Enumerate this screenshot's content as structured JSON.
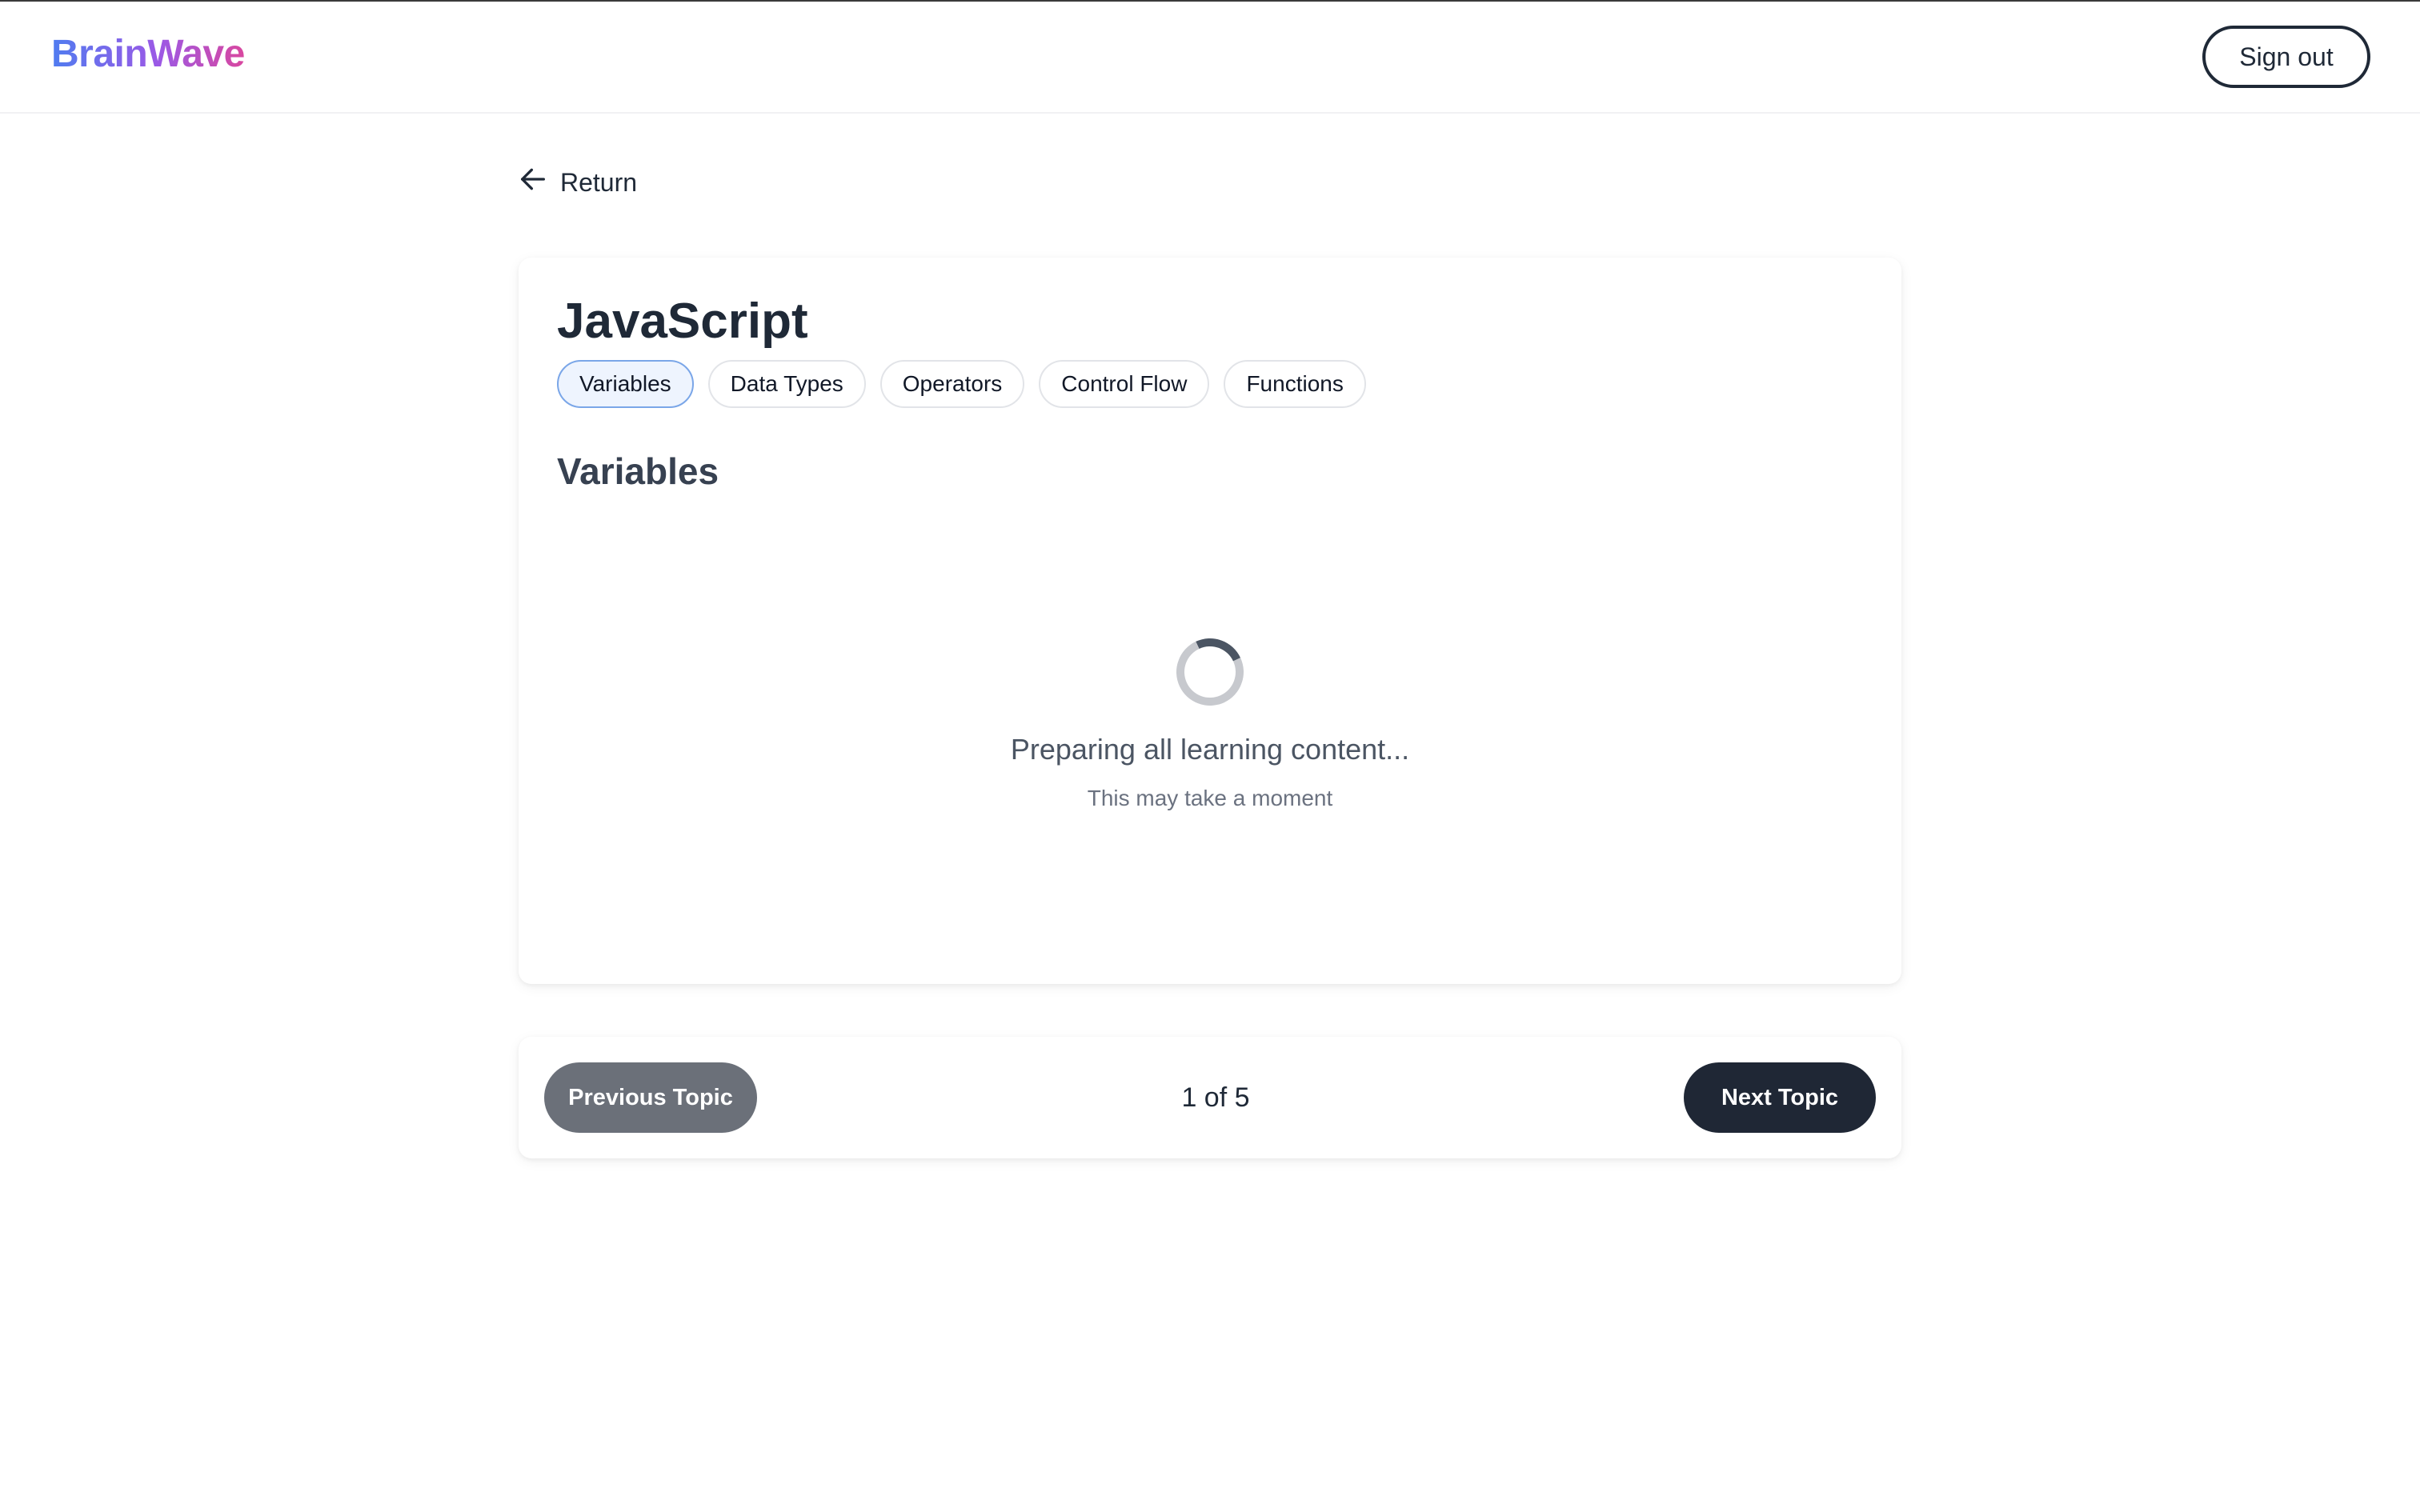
{
  "header": {
    "logo": "BrainWave",
    "signout_label": "Sign out"
  },
  "nav": {
    "return_label": "Return"
  },
  "course": {
    "title": "JavaScript",
    "topics": [
      {
        "label": "Variables",
        "active": true
      },
      {
        "label": "Data Types",
        "active": false
      },
      {
        "label": "Operators",
        "active": false
      },
      {
        "label": "Control Flow",
        "active": false
      },
      {
        "label": "Functions",
        "active": false
      }
    ],
    "current_topic": "Variables"
  },
  "loading": {
    "message": "Preparing all learning content...",
    "submessage": "This may take a moment"
  },
  "pager": {
    "prev_label": "Previous Topic",
    "next_label": "Next Topic",
    "counter": "1 of 5"
  },
  "colors": {
    "logo_gradient_start": "#4f7cf0",
    "logo_gradient_end": "#d9479f",
    "active_chip_bg": "#eef4fe",
    "active_chip_border": "#7aa6e8",
    "prev_button": "#6b7079",
    "next_button": "#1f2735"
  }
}
